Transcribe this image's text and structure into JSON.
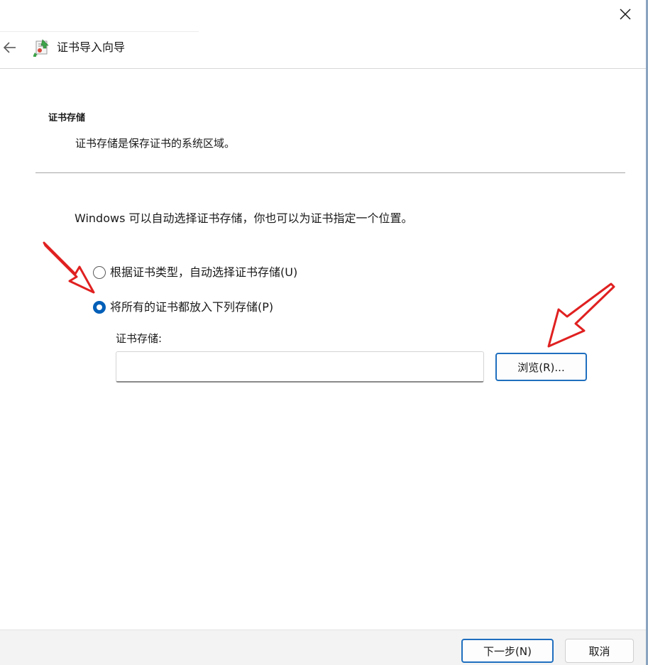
{
  "window": {
    "close_label": "close"
  },
  "header": {
    "title": "证书导入向导",
    "back_icon": "arrow-left-icon",
    "wizard_icon": "certificate-wizard-icon"
  },
  "section": {
    "title": "证书存储",
    "description": "证书存储是保存证书的系统区域。"
  },
  "instructions": "Windows 可以自动选择证书存储，你也可以为证书指定一个位置。",
  "options": [
    {
      "label": "根据证书类型，自动选择证书存储(U)",
      "checked": false
    },
    {
      "label": "将所有的证书都放入下列存储(P)",
      "checked": true
    }
  ],
  "store": {
    "label": "证书存储:",
    "value": "",
    "browse_label": "浏览(R)..."
  },
  "footer": {
    "next_label": "下一步(N)",
    "cancel_label": "取消"
  },
  "annotations": {
    "arrow_color": "#e02020"
  },
  "colors": {
    "accent": "#005fb8",
    "footer_bg": "#f3f3f3"
  }
}
